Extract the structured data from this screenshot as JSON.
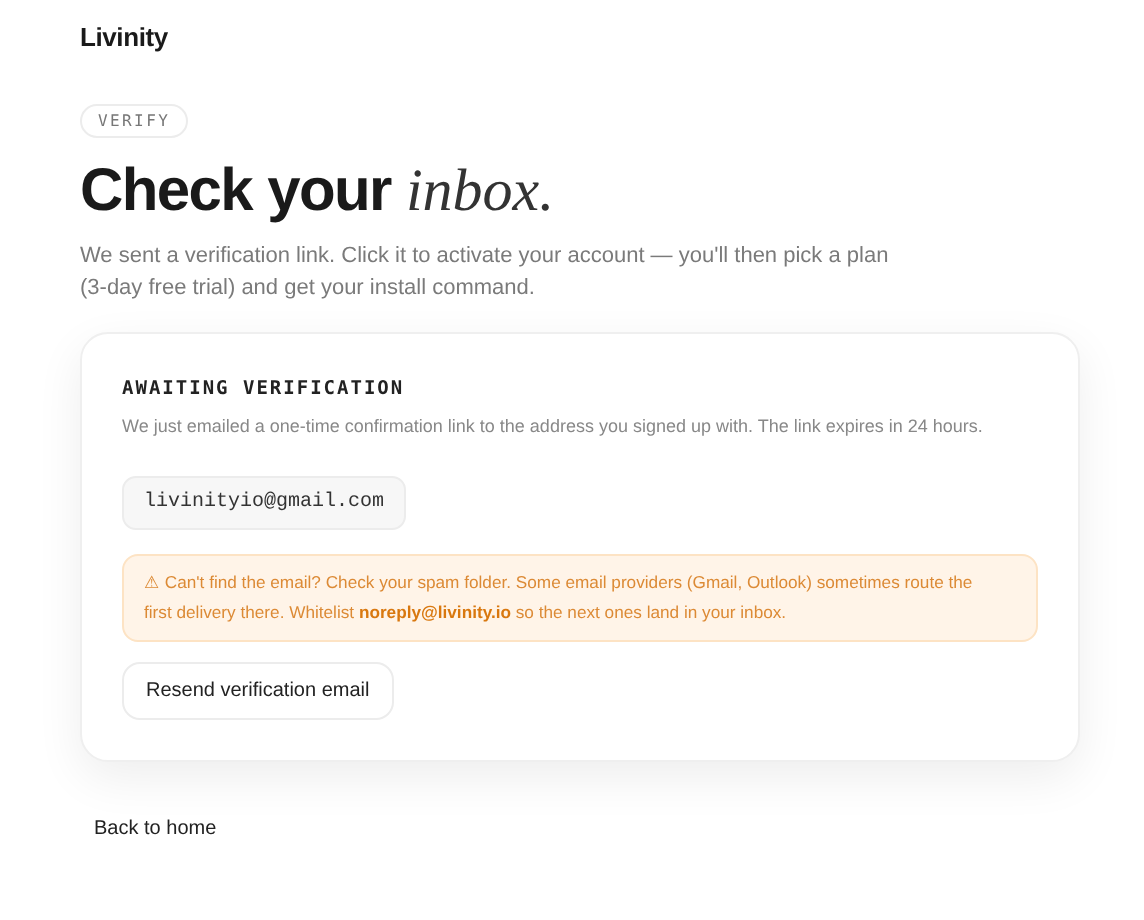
{
  "brand": "Livinity",
  "badge": "VERIFY",
  "title": "Check your *inbox.*",
  "subtitle": "We sent a verification link. Click it to activate your account — you'll then pick a plan (3-day free trial) and get your install command.",
  "card": {
    "heading": "AWAITING VERIFICATION",
    "description": "We just emailed a one-time confirmation link to the address you signed up with. The link expires in 24 hours.",
    "email": "livinityio@gmail.com",
    "notice": "⚠ Can't find the email? Check your spam folder. Some email providers (Gmail, Outlook) sometimes route the first delivery there. Whitelist **noreply@livinity.io** so the next ones land in your inbox.",
    "button": "Resend verification email"
  },
  "back_link": "Back to home"
}
